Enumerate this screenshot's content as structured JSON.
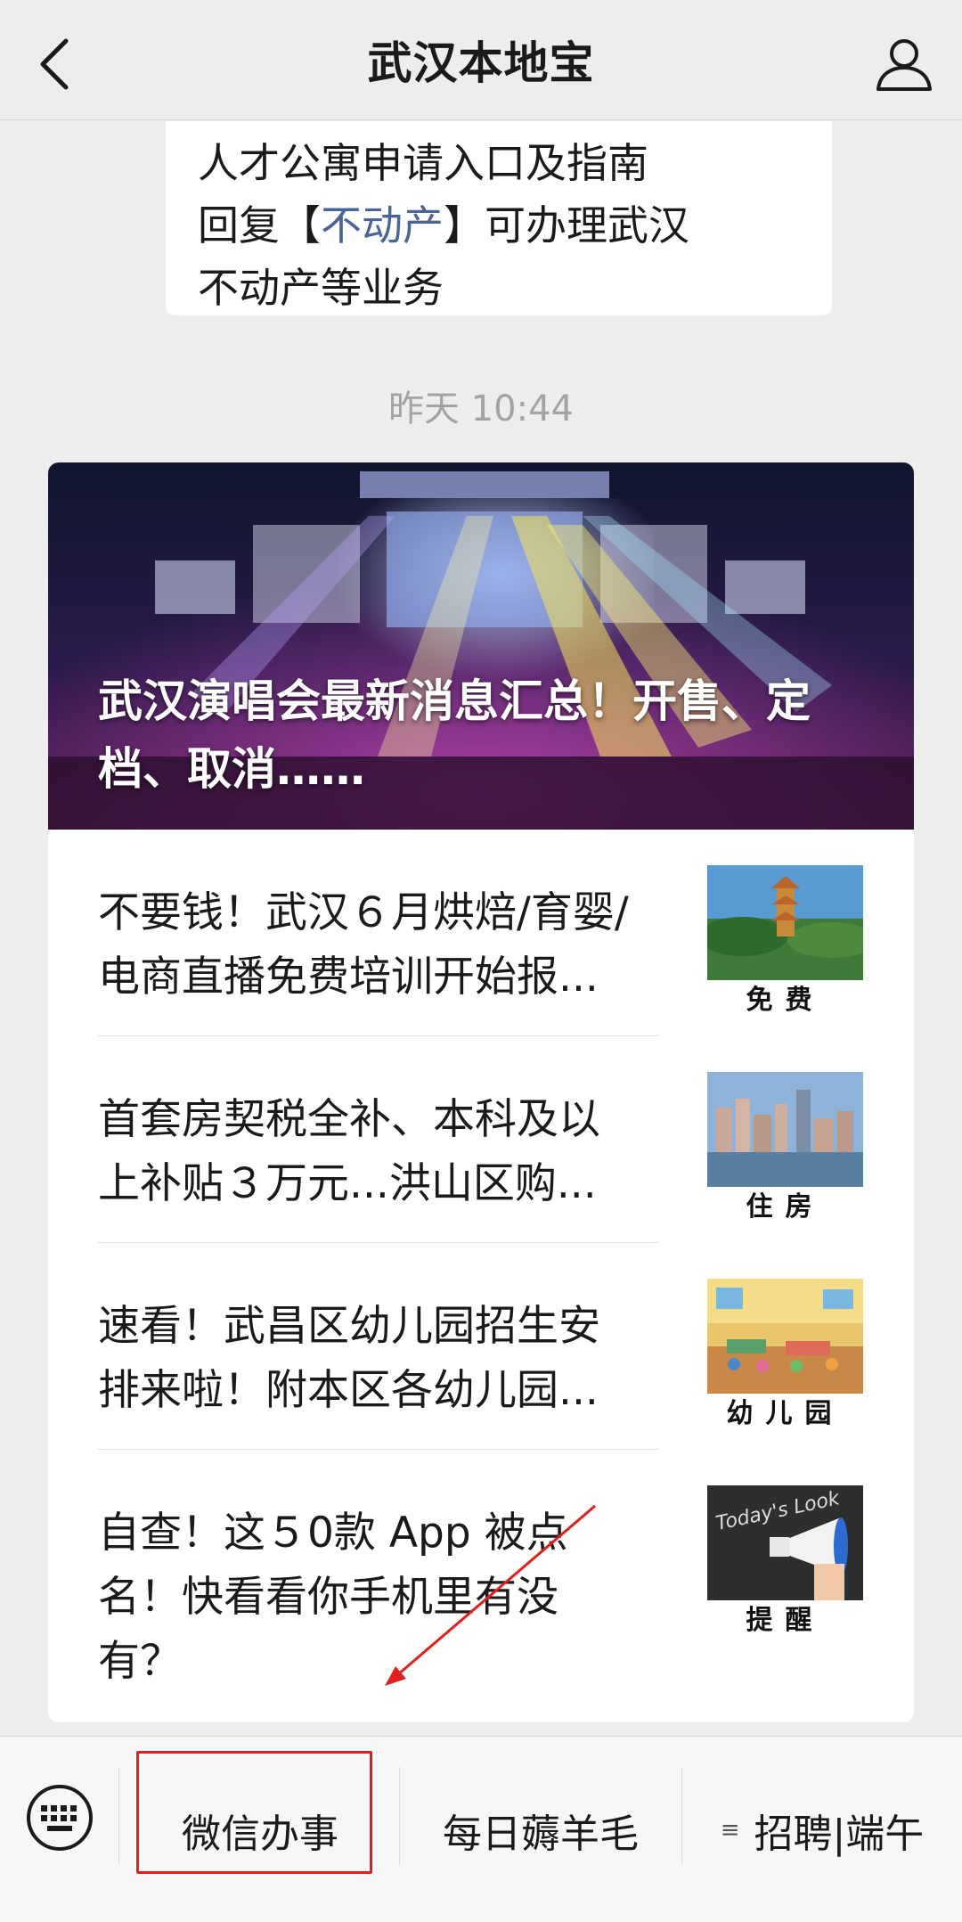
{
  "header": {
    "back_icon": "chevron-left-icon",
    "title": "武汉本地宝",
    "profile_icon": "user-icon"
  },
  "text_message": {
    "line1": "人才公寓申请入口及指南",
    "line2_pre": "回复【",
    "line2_link": "不动产",
    "line2_post": "】可办理武汉",
    "line3": "不动产等业务"
  },
  "timestamp": "昨天 10:44",
  "card": {
    "hero_title": "武汉演唱会最新消息汇总！开售、定档、取消……",
    "articles": [
      {
        "title": "不要钱！武汉６月烘焙/育婴/电商直播免费培训开始报...",
        "tag": "免费"
      },
      {
        "title": "首套房契税全补、本科及以上补贴３万元...洪山区购...",
        "tag": "住房"
      },
      {
        "title": "速看！武昌区幼儿园招生安排来啦！附本区各幼儿园...",
        "tag": "幼儿园"
      },
      {
        "title": "自查！这５0款 App 被点名！快看看你手机里有没有？",
        "tag": "提醒",
        "thumb_text": "Today's Look"
      }
    ]
  },
  "menu": {
    "keyboard_icon": "keyboard-icon",
    "items": [
      "微信办事",
      "每日薅羊毛",
      "招聘|端午"
    ],
    "list_icon": "≡"
  },
  "colors": {
    "background": "#ededed",
    "link": "#4a6595",
    "highlight_box": "#e02020",
    "timestamp": "#a3a3a3"
  }
}
